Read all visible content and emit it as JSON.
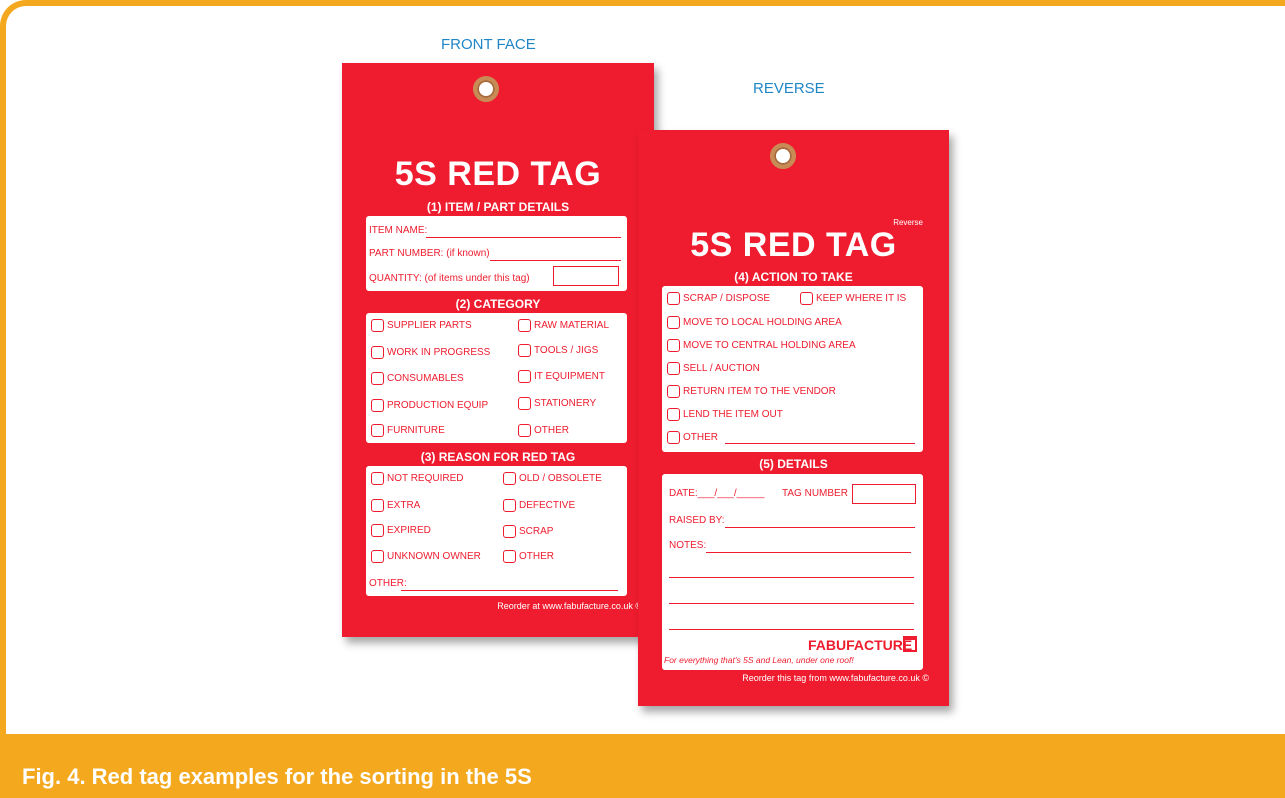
{
  "figure": {
    "front_label": "FRONT FACE",
    "reverse_label": "REVERSE",
    "caption": "Fig. 4. Red tag examples for the sorting in the 5S"
  },
  "colors": {
    "tag_red": "#EE1C2E",
    "accent_orange": "#F4A81D",
    "label_blue": "#1F86C6"
  },
  "front": {
    "title": "5S RED TAG",
    "sec1": "(1) ITEM / PART DETAILS",
    "item_name": "ITEM NAME:",
    "part_number": "PART NUMBER: (if known)",
    "quantity": "QUANTITY: (of items under this tag)",
    "sec2": "(2) CATEGORY",
    "categories": [
      "SUPPLIER PARTS",
      "RAW MATERIAL",
      "WORK IN PROGRESS",
      "TOOLS / JIGS",
      "CONSUMABLES",
      "IT EQUIPMENT",
      "PRODUCTION EQUIP",
      "STATIONERY",
      "FURNITURE",
      "OTHER"
    ],
    "sec3": "(3) REASON FOR RED TAG",
    "reasons": [
      "NOT REQUIRED",
      "OLD / OBSOLETE",
      "EXTRA",
      "DEFECTIVE",
      "EXPIRED",
      "SCRAP",
      "UNKNOWN OWNER",
      "OTHER"
    ],
    "other": "OTHER:",
    "reorder": "Reorder at www.fabufacture.co.uk ©"
  },
  "reverse": {
    "small_label": "Reverse",
    "title": "5S RED TAG",
    "sec4": "(4) ACTION TO TAKE",
    "actions": [
      "SCRAP / DISPOSE",
      "KEEP WHERE IT IS",
      "MOVE TO LOCAL HOLDING AREA",
      "MOVE TO CENTRAL HOLDING AREA",
      "SELL / AUCTION",
      "RETURN ITEM TO THE VENDOR",
      "LEND THE ITEM OUT",
      "OTHER"
    ],
    "sec5": "(5) DETAILS",
    "date": "DATE:___/___/_____",
    "tag_number": "TAG NUMBER",
    "raised_by": "RAISED BY:",
    "notes": "NOTES:",
    "brand": "FABUFACTURE",
    "slogan": "For everything that's 5S and Lean, under one roof!",
    "reorder": "Reorder this tag from www.fabufacture.co.uk ©"
  }
}
